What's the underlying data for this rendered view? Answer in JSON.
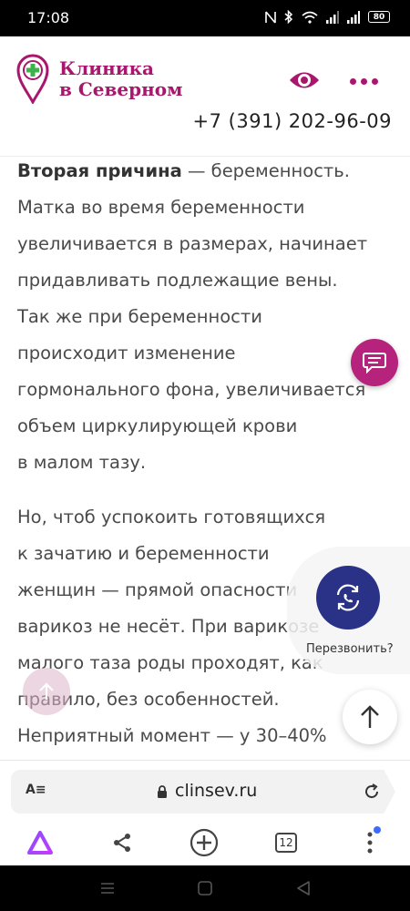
{
  "status_bar": {
    "time": "17:08",
    "battery": "80",
    "icons": [
      "nfc-icon",
      "bluetooth-icon",
      "wifi-icon",
      "signal-icon",
      "signal-icon",
      "battery-icon"
    ]
  },
  "header": {
    "logo_line1": "Клиника",
    "logo_line2": "в Северном",
    "phone": "+7 (391) 202-96-09",
    "brand_color": "#a8176c",
    "accessibility_icon": "eye-icon",
    "menu_icon": "more-dots-icon"
  },
  "article": {
    "p1": {
      "bold": "Вторая причина",
      "lines": [
        " — беременность.",
        "Матка во время беременности",
        "увеличивается в размерах, начинает",
        "придавливать подлежащие вены.",
        "Так же при беременности",
        "происходит изменение",
        "гормонального фона, увеличивается",
        "объем циркулирующей крови",
        "в малом тазу."
      ]
    },
    "p2": {
      "lines": [
        "Но, чтоб успокоить готовящихся",
        "к зачатию и беременности",
        "женщин — прямой опасности",
        "варикоз не несёт. При варикозе",
        "малого таза роды проходят, как",
        "правило, без особенностей.",
        "Неприятный момент — у 30–40%"
      ]
    }
  },
  "widgets": {
    "callback_label": "Перезвонить?",
    "chat_color": "#b5237d",
    "callback_color": "#2a3288"
  },
  "address_bar": {
    "url": "clinsev.ru",
    "reader_label": "A≡"
  },
  "browser_nav": {
    "tabs_count": "12"
  }
}
